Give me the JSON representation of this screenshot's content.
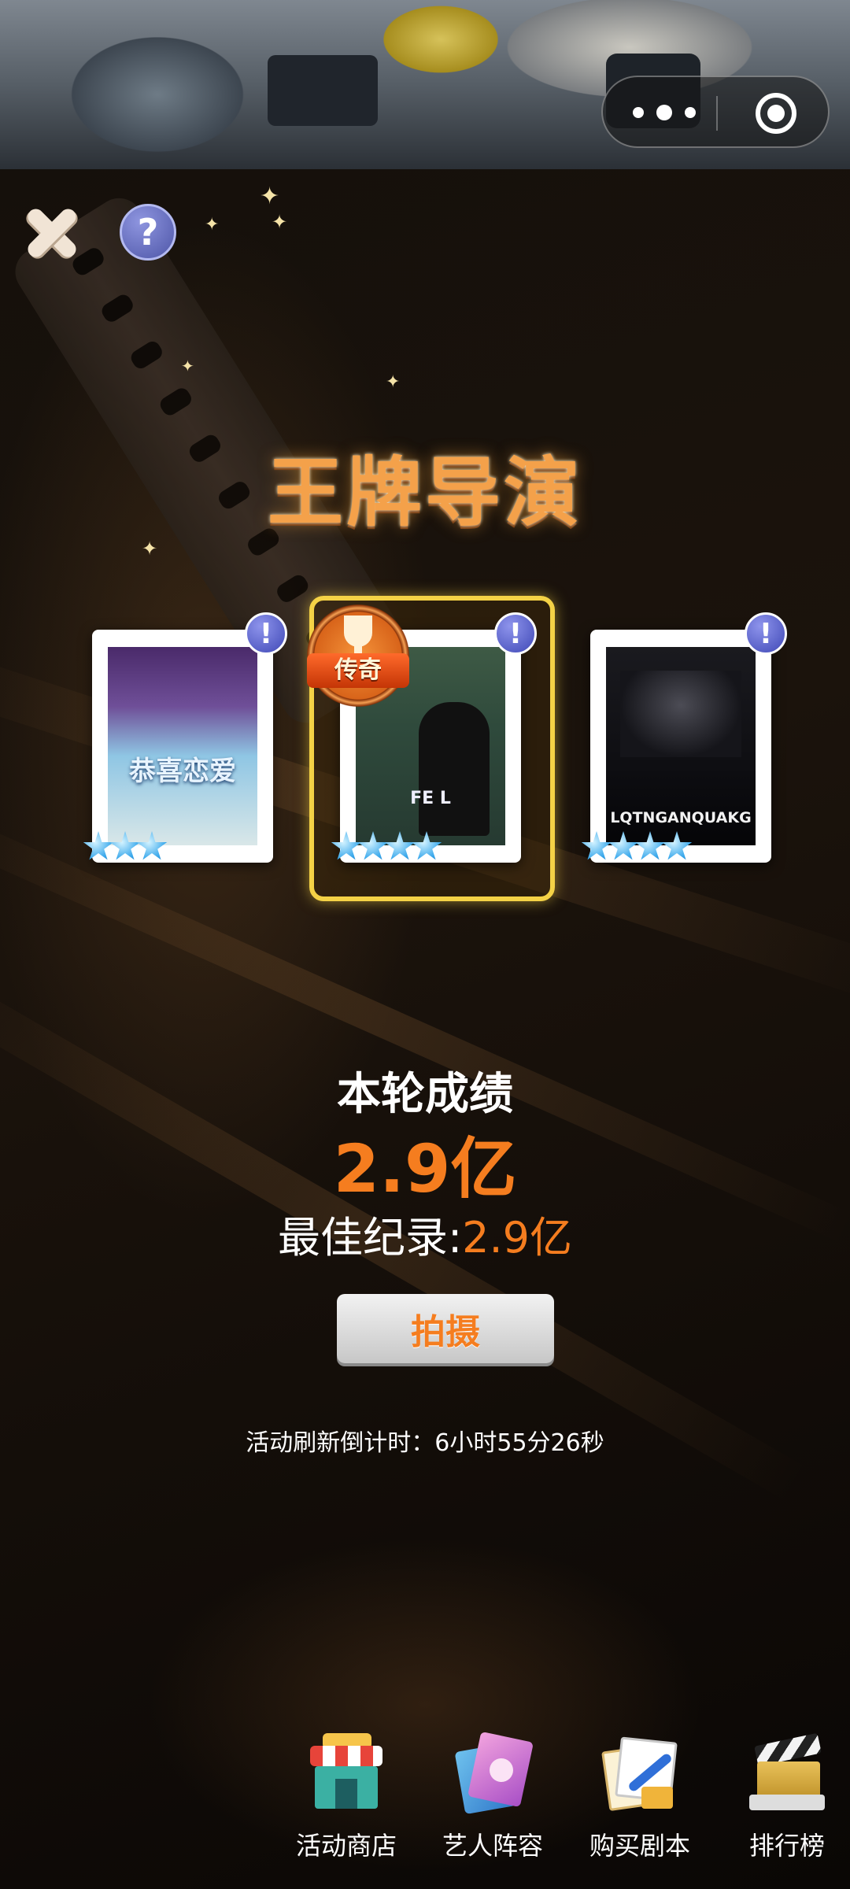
{
  "topbar": {
    "more_icon": "more-dots-icon",
    "close_icon": "target-circle-icon"
  },
  "controls": {
    "close_icon": "close-x-icon",
    "help_icon": "question-icon",
    "help_symbol": "?"
  },
  "title": "王牌导演",
  "cards": [
    {
      "poster_text": "恭喜恋爱",
      "alert": "!",
      "stars": 3
    },
    {
      "poster_text": "FE   L",
      "alert": "!",
      "stars": 4,
      "badge": "传奇",
      "highlighted": true
    },
    {
      "poster_text": "LQTNGANQUAKG",
      "alert": "!",
      "stars": 4
    }
  ],
  "results": {
    "round_label": "本轮成绩",
    "round_value": "2.9亿",
    "best_label": "最佳纪录:",
    "best_value": "2.9亿"
  },
  "shoot_button": "拍摄",
  "countdown": "活动刷新倒计时：6小时55分26秒",
  "nav": [
    {
      "label": "活动商店",
      "icon": "store-icon"
    },
    {
      "label": "艺人阵容",
      "icon": "artist-album-icon"
    },
    {
      "label": "购买剧本",
      "icon": "script-icon"
    },
    {
      "label": "排行榜",
      "icon": "clapperboard-icon"
    }
  ],
  "colors": {
    "accent_orange": "#f57d1f",
    "highlight_gold": "#f4d246",
    "alert_blue": "#3f48b6",
    "star_blue": "#3ba9ec"
  }
}
